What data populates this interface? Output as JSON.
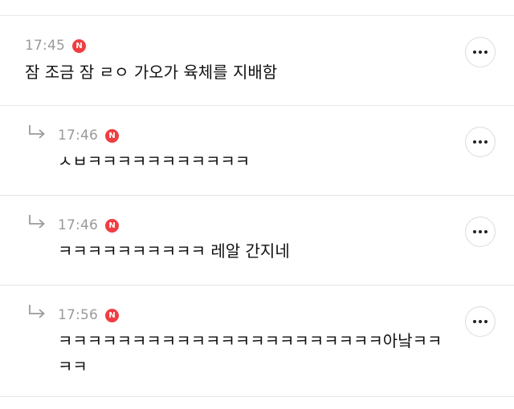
{
  "comments": [
    {
      "time": "17:45",
      "badge": "N",
      "text": "잠 조금 잠 ㄹㅇ 가오가 육체를 지배함",
      "is_reply": false
    },
    {
      "time": "17:46",
      "badge": "N",
      "text": "ㅅㅂㅋㅋㅋㅋㅋㅋㅋㅋㅋㅋㅋ",
      "is_reply": true
    },
    {
      "time": "17:46",
      "badge": "N",
      "text": "ㅋㅋㅋㅋㅋㅋㅋㅋㅋㅋ 레알 간지네",
      "is_reply": true
    },
    {
      "time": "17:56",
      "badge": "N",
      "text": "ㅋㅋㅋㅋㅋㅋㅋㅋㅋㅋㅋㅋㅋㅋㅋㅋㅋㅋㅋㅋㅋㅋ아낰ㅋㅋㅋㅋ",
      "is_reply": true
    }
  ],
  "colors": {
    "badge": "#ef3e42",
    "time": "#9a9a9a",
    "divider": "#e6e6e6"
  },
  "icons": {
    "reply": "reply-arrow-icon",
    "more": "more-dots-icon",
    "new_badge": "new-badge-icon"
  }
}
